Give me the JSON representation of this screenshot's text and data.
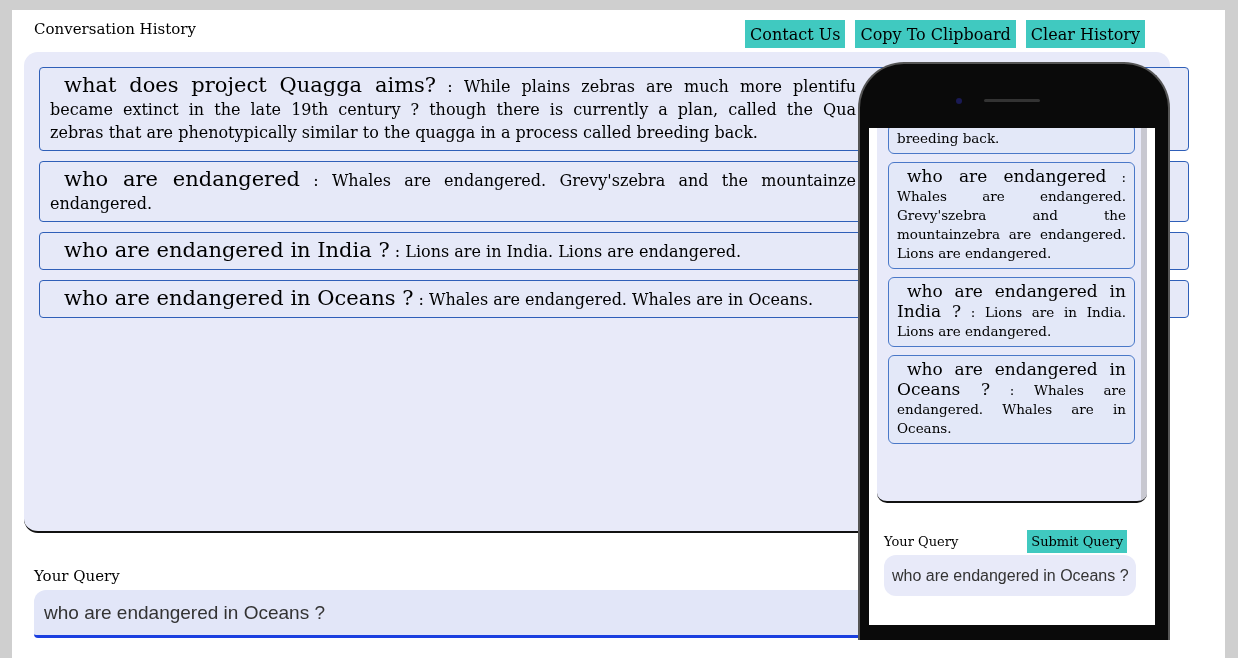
{
  "header": {
    "title": "Conversation History",
    "buttons": [
      "Contact Us",
      "Copy To Clipboard",
      "Clear History"
    ]
  },
  "history": [
    {
      "question": "what does project Quagga aims?",
      "answer_lines": [
        ": While plains zebras are much more plentifu",
        "became extinct in the late 19th century ? though there is currently a plan, called the Qua",
        "zebras that are phenotypically similar to the quagga in a process called breeding back."
      ]
    },
    {
      "question": "who are endangered",
      "answer_lines": [
        ": Whales are endangered. Grevy'szebra and the mountainze",
        "endangered."
      ]
    },
    {
      "question": "who are endangered in India ?",
      "answer_lines": [
        ": Lions are in India. Lions are endangered."
      ]
    },
    {
      "question": "who are endangered in Oceans ?",
      "answer_lines": [
        ": Whales are endangered. Whales are in Oceans."
      ]
    }
  ],
  "query": {
    "label": "Your Query",
    "value": "who are endangered in Oceans ?"
  },
  "phone": {
    "history": [
      {
        "answer": "breeding back."
      },
      {
        "question": "who are endangered",
        "answer": ": Whales are endangered. Grevy'szebra and the mountainzebra are endangered. Lions are endangered."
      },
      {
        "question": "who are endangered in India ?",
        "answer": ": Lions are in India. Lions are endangered."
      },
      {
        "question": "who are endangered in Oceans ?",
        "answer": ": Whales are endangered. Whales are in Oceans."
      }
    ],
    "query_label": "Your Query",
    "submit": "Submit Query",
    "query_value": "who are endangered in Oceans ?"
  }
}
